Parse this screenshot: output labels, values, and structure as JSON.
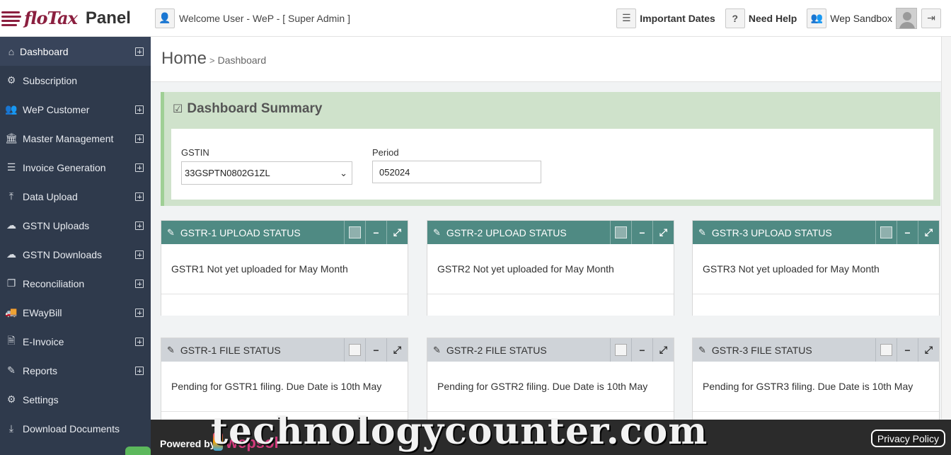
{
  "brand": {
    "logo_name": "floTax",
    "panel_label": "Panel"
  },
  "sidebar": {
    "items": [
      {
        "label": "Dashboard",
        "icon": "home-icon",
        "glyph": "⌂",
        "expandable": true
      },
      {
        "label": "Subscription",
        "icon": "gears-icon",
        "glyph": "⚙",
        "expandable": false
      },
      {
        "label": "WeP Customer",
        "icon": "users-icon",
        "glyph": "👥",
        "expandable": true
      },
      {
        "label": "Master Management",
        "icon": "bank-icon",
        "glyph": "🏛",
        "expandable": true
      },
      {
        "label": "Invoice Generation",
        "icon": "list-icon",
        "glyph": "☰",
        "expandable": true
      },
      {
        "label": "Data Upload",
        "icon": "upload-icon",
        "glyph": "⤒",
        "expandable": true
      },
      {
        "label": "GSTN Uploads",
        "icon": "cloud-upload-icon",
        "glyph": "☁",
        "expandable": true
      },
      {
        "label": "GSTN Downloads",
        "icon": "cloud-download-icon",
        "glyph": "☁",
        "expandable": true
      },
      {
        "label": "Reconciliation",
        "icon": "clone-icon",
        "glyph": "❐",
        "expandable": true
      },
      {
        "label": "EWayBill",
        "icon": "truck-icon",
        "glyph": "🚚",
        "expandable": true
      },
      {
        "label": "E-Invoice",
        "icon": "file-icon",
        "glyph": "🗎",
        "expandable": true
      },
      {
        "label": "Reports",
        "icon": "edit-icon",
        "glyph": "✎",
        "expandable": true
      },
      {
        "label": "Settings",
        "icon": "gears-icon",
        "glyph": "⚙",
        "expandable": false
      },
      {
        "label": "Download Documents",
        "icon": "download-icon",
        "glyph": "⤓",
        "expandable": false
      }
    ]
  },
  "header": {
    "welcome": "Welcome User - WeP - [ Super Admin ]",
    "important_dates": "Important Dates",
    "need_help": "Need Help",
    "account": "Wep Sandbox"
  },
  "page": {
    "title": "Home",
    "separator": ">",
    "subtitle": "Dashboard"
  },
  "summary": {
    "title": "Dashboard Summary",
    "gstin_label": "GSTIN",
    "gstin_value": "33GSPTN0802G1ZL",
    "period_label": "Period",
    "period_value": "052024"
  },
  "cards": {
    "upload": [
      {
        "title": "GSTR-1 UPLOAD STATUS",
        "body": "GSTR1 Not yet uploaded for May Month"
      },
      {
        "title": "GSTR-2 UPLOAD STATUS",
        "body": "GSTR2 Not yet uploaded for May Month"
      },
      {
        "title": "GSTR-3 UPLOAD STATUS",
        "body": "GSTR3 Not yet uploaded for May Month"
      }
    ],
    "file": [
      {
        "title": "GSTR-1 FILE STATUS",
        "body": "Pending for GSTR1 filing. Due Date is 10th May"
      },
      {
        "title": "GSTR-2 FILE STATUS",
        "body": "Pending for GSTR2 filing. Due Date is 10th May"
      },
      {
        "title": "GSTR-3 FILE STATUS",
        "body": "Pending for GSTR3 filing. Due Date is 10th May"
      }
    ]
  },
  "footer": {
    "powered_by": "Powered by",
    "brand": "wepsol",
    "watermark": "technologycounter.com",
    "privacy": "Privacy Policy"
  },
  "colors": {
    "sidebar_bg": "#2f3a4c",
    "upload_header": "#4f8a83",
    "file_header": "#cfd3d8",
    "summary_bg": "#cfe2cb",
    "brand_maroon": "#8b1f3f"
  }
}
